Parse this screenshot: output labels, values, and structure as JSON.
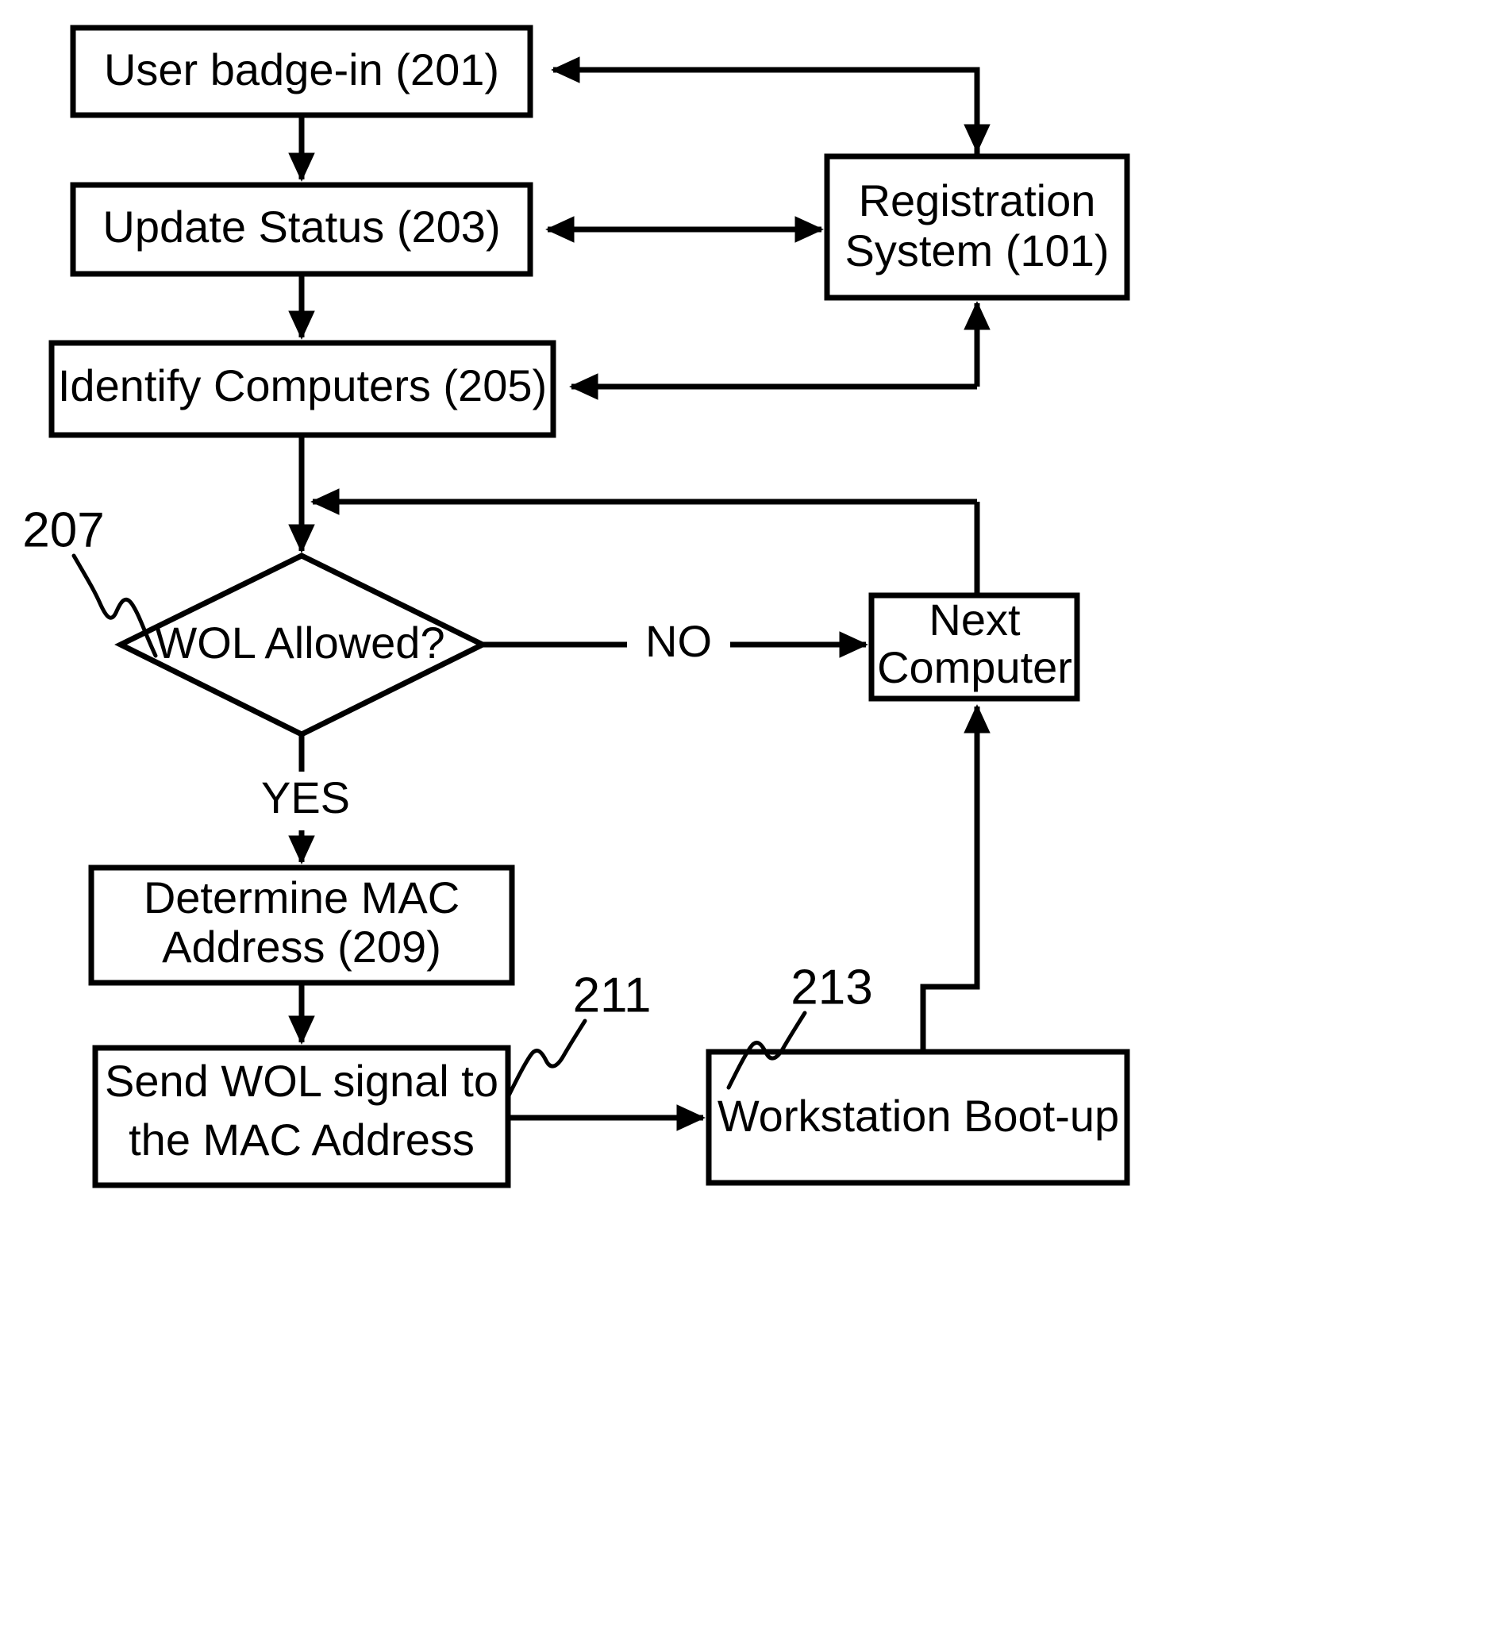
{
  "figure": {
    "type": "flowchart",
    "title": "Wake-on-LAN badge-in process flow",
    "background_color": "#ffffff",
    "line_color": "#000000"
  },
  "nodes": {
    "user_badge_in": {
      "label": "User badge-in (201)",
      "shape": "rectangle",
      "ref": "201"
    },
    "update_status": {
      "label": "Update Status (203)",
      "shape": "rectangle",
      "ref": "203"
    },
    "identify_computers": {
      "label": "Identify Computers (205)",
      "shape": "rectangle",
      "ref": "205"
    },
    "registration_system": {
      "line1": "Registration",
      "line2": "System (101)",
      "shape": "rectangle",
      "ref": "101"
    },
    "wol_allowed": {
      "label": "WOL Allowed?",
      "shape": "diamond",
      "ref": "207"
    },
    "next_computer": {
      "line1": "Next",
      "line2": "Computer",
      "shape": "rectangle"
    },
    "determine_mac": {
      "line1": "Determine MAC",
      "line2": "Address (209)",
      "shape": "rectangle",
      "ref": "209"
    },
    "send_wol": {
      "line1": "Send WOL signal to",
      "line2": "the MAC Address",
      "shape": "rectangle",
      "ref": "211"
    },
    "workstation_boot": {
      "label": "Workstation Boot-up",
      "shape": "rectangle",
      "ref": "213"
    }
  },
  "edge_labels": {
    "no": "NO",
    "yes": "YES"
  },
  "reference_numerals": {
    "decision": "207",
    "send_wol_box": "211",
    "workstation_box": "213"
  },
  "chart_data": {
    "type": "diagram",
    "edges": [
      {
        "from": "user_badge_in",
        "to": "update_status",
        "label": ""
      },
      {
        "from": "update_status",
        "to": "identify_computers",
        "label": ""
      },
      {
        "from": "update_status",
        "to": "registration_system",
        "label": "",
        "bidirectional": true
      },
      {
        "from": "registration_system",
        "to": "user_badge_in",
        "label": ""
      },
      {
        "from": "registration_system",
        "to": "identify_computers",
        "label": ""
      },
      {
        "from": "identify_computers",
        "to": "wol_allowed",
        "label": ""
      },
      {
        "from": "wol_allowed",
        "to": "next_computer",
        "label": "NO"
      },
      {
        "from": "wol_allowed",
        "to": "determine_mac",
        "label": "YES"
      },
      {
        "from": "determine_mac",
        "to": "send_wol",
        "label": ""
      },
      {
        "from": "send_wol",
        "to": "workstation_boot",
        "label": ""
      },
      {
        "from": "workstation_boot",
        "to": "next_computer",
        "label": ""
      },
      {
        "from": "next_computer",
        "to": "wol_allowed",
        "label": ""
      }
    ]
  }
}
